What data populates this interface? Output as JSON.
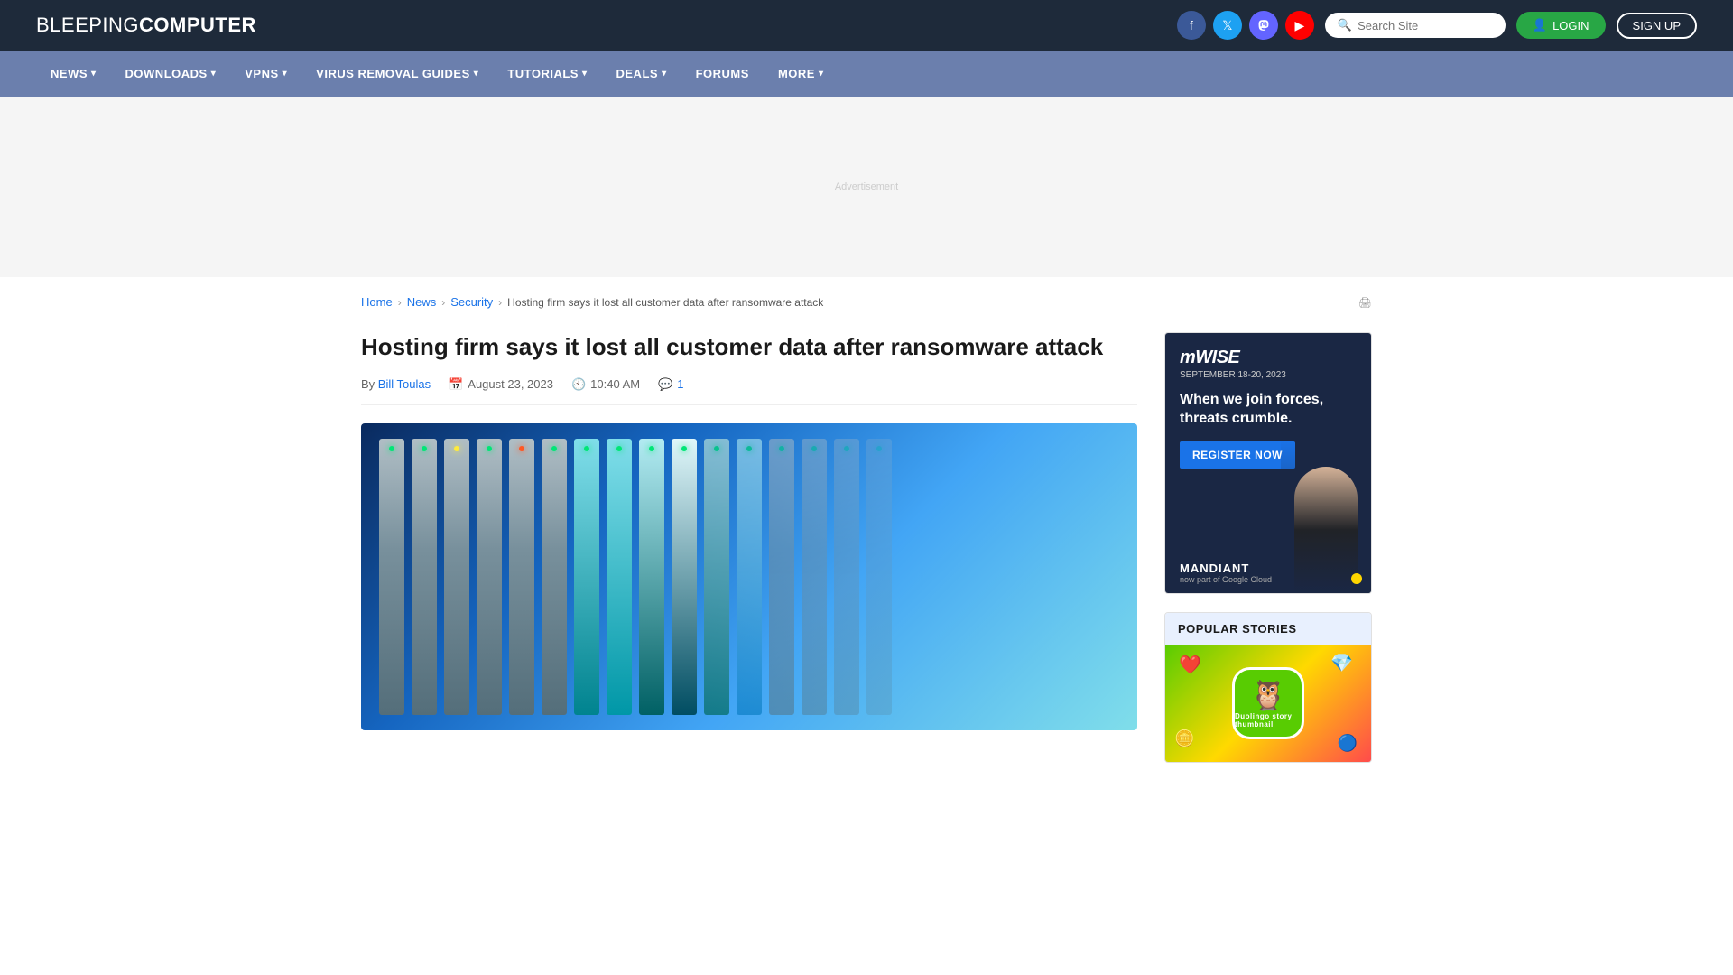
{
  "header": {
    "logo_light": "BLEEPING",
    "logo_bold": "COMPUTER",
    "search_placeholder": "Search Site",
    "login_label": "LOGIN",
    "signup_label": "SIGN UP",
    "social": [
      {
        "name": "facebook",
        "symbol": "f"
      },
      {
        "name": "twitter",
        "symbol": "𝕏"
      },
      {
        "name": "mastodon",
        "symbol": "m"
      },
      {
        "name": "youtube",
        "symbol": "▶"
      }
    ]
  },
  "nav": {
    "items": [
      {
        "label": "NEWS",
        "has_dropdown": true
      },
      {
        "label": "DOWNLOADS",
        "has_dropdown": true
      },
      {
        "label": "VPNS",
        "has_dropdown": true
      },
      {
        "label": "VIRUS REMOVAL GUIDES",
        "has_dropdown": true
      },
      {
        "label": "TUTORIALS",
        "has_dropdown": true
      },
      {
        "label": "DEALS",
        "has_dropdown": true
      },
      {
        "label": "FORUMS",
        "has_dropdown": false
      },
      {
        "label": "MORE",
        "has_dropdown": true
      }
    ]
  },
  "breadcrumb": {
    "home": "Home",
    "news": "News",
    "security": "Security",
    "current": "Hosting firm says it lost all customer data after ransomware attack"
  },
  "article": {
    "title": "Hosting firm says it lost all customer data after ransomware attack",
    "author_label": "By",
    "author_name": "Bill Toulas",
    "date": "August 23, 2023",
    "time": "10:40 AM",
    "comments_count": "1"
  },
  "sidebar_ad": {
    "logo": "mWISE",
    "date": "SEPTEMBER 18-20, 2023",
    "headline": "When we join forces, threats crumble.",
    "register_btn": "REGISTER NOW",
    "brand": "MANDIANT",
    "brand_sub": "now part of Google Cloud"
  },
  "popular_stories": {
    "header": "POPULAR STORIES",
    "first_image_alt": "Duolingo story thumbnail"
  }
}
